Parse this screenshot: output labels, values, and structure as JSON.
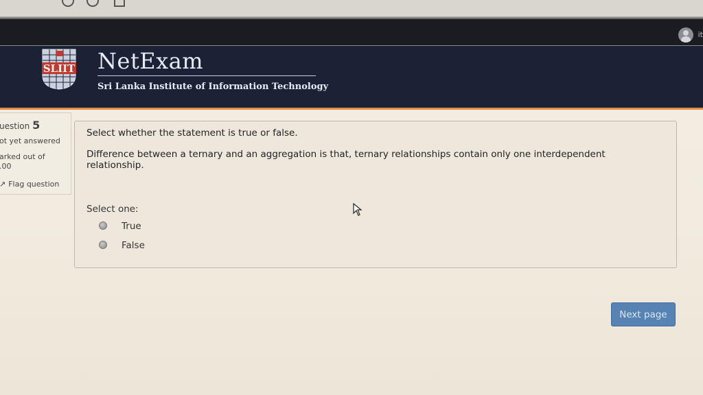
{
  "header": {
    "brand_title": "NetExam",
    "brand_subtitle": "Sri Lanka Institute of Information Technology",
    "logo_text": "SLIIT",
    "user_name": "it"
  },
  "question_info": {
    "label": "uestion",
    "number": "5",
    "status": "ot yet answered",
    "marked_label": "arked out of",
    "mark": ".00",
    "flag_label": "Flag question"
  },
  "question": {
    "instruction": "Select whether the statement is true or false.",
    "statement": "Difference between a ternary and an aggregation is that, ternary relationships contain only one interdependent relationship.",
    "select_one": "Select one:",
    "options": [
      {
        "label": "True",
        "selected": false
      },
      {
        "label": "False",
        "selected": false
      }
    ]
  },
  "navigation": {
    "next_label": "Next page"
  },
  "colors": {
    "header_bg": "#1b2236",
    "accent_rule": "#e08b4a",
    "button_bg": "#5683b4"
  }
}
